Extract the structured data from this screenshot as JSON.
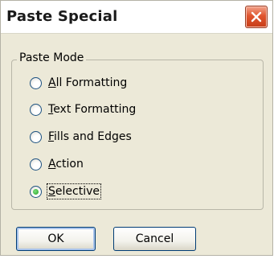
{
  "window": {
    "title": "Paste Special"
  },
  "close_icon": "close-icon",
  "paste_mode": {
    "legend": "Paste Mode",
    "options": [
      {
        "label": "All Formatting",
        "access_key": "A",
        "selected": false
      },
      {
        "label": "Text Formatting",
        "access_key": "T",
        "selected": false
      },
      {
        "label": "Fills and Edges",
        "access_key": "F",
        "selected": false
      },
      {
        "label": "Action",
        "access_key": "A",
        "selected": false
      },
      {
        "label": "Selective",
        "access_key": "S",
        "selected": true
      }
    ]
  },
  "buttons": {
    "ok": "OK",
    "cancel": "Cancel"
  },
  "colors": {
    "dialog_face": "#ece9d8",
    "close_button": "#e0552e",
    "button_border": "#003c74",
    "radio_dot": "#21a121"
  }
}
